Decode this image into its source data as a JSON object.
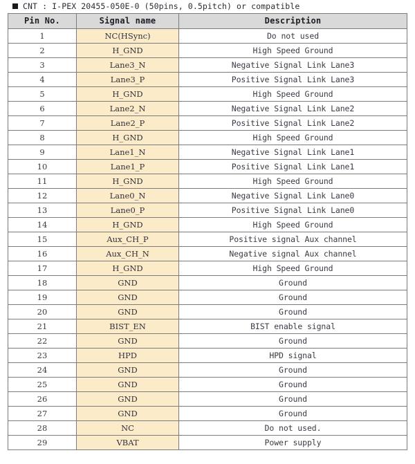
{
  "caption": {
    "bullet_icon": "filled-square-bullet",
    "text": "CNT :  I-PEX 20455-050E-0 (50pins, 0.5pitch) or compatible"
  },
  "table": {
    "columns": [
      "Pin No.",
      "Signal name",
      "Description"
    ],
    "rows": [
      {
        "pin": "1",
        "signal": "NC(HSync)",
        "description": "Do not used"
      },
      {
        "pin": "2",
        "signal": "H_GND",
        "description": "High Speed Ground"
      },
      {
        "pin": "3",
        "signal": "Lane3_N",
        "description": "Negative Signal Link Lane3"
      },
      {
        "pin": "4",
        "signal": "Lane3_P",
        "description": "Positive Signal Link Lane3"
      },
      {
        "pin": "5",
        "signal": "H_GND",
        "description": "High Speed Ground"
      },
      {
        "pin": "6",
        "signal": "Lane2_N",
        "description": "Negative Signal Link Lane2"
      },
      {
        "pin": "7",
        "signal": "Lane2_P",
        "description": "Positive Signal Link Lane2"
      },
      {
        "pin": "8",
        "signal": "H_GND",
        "description": "High Speed Ground"
      },
      {
        "pin": "9",
        "signal": "Lane1_N",
        "description": "Negative Signal Link Lane1"
      },
      {
        "pin": "10",
        "signal": "Lane1_P",
        "description": "Positive Signal Link Lane1"
      },
      {
        "pin": "11",
        "signal": "H_GND",
        "description": "High Speed Ground"
      },
      {
        "pin": "12",
        "signal": "Lane0_N",
        "description": "Negative Signal Link Lane0"
      },
      {
        "pin": "13",
        "signal": "Lane0_P",
        "description": "Positive Signal Link Lane0"
      },
      {
        "pin": "14",
        "signal": "H_GND",
        "description": "High Speed Ground"
      },
      {
        "pin": "15",
        "signal": "Aux_CH_P",
        "description": "Positive signal Aux channel"
      },
      {
        "pin": "16",
        "signal": "Aux_CH_N",
        "description": "Negative signal Aux channel"
      },
      {
        "pin": "17",
        "signal": "H_GND",
        "description": "High Speed Ground"
      },
      {
        "pin": "18",
        "signal": "GND",
        "description": "Ground"
      },
      {
        "pin": "19",
        "signal": "GND",
        "description": "Ground"
      },
      {
        "pin": "20",
        "signal": "GND",
        "description": "Ground"
      },
      {
        "pin": "21",
        "signal": "BIST_EN",
        "description": "BIST enable signal"
      },
      {
        "pin": "22",
        "signal": "GND",
        "description": "Ground"
      },
      {
        "pin": "23",
        "signal": "HPD",
        "description": "HPD signal"
      },
      {
        "pin": "24",
        "signal": "GND",
        "description": "Ground"
      },
      {
        "pin": "25",
        "signal": "GND",
        "description": "Ground"
      },
      {
        "pin": "26",
        "signal": "GND",
        "description": "Ground"
      },
      {
        "pin": "27",
        "signal": "GND",
        "description": "Ground"
      },
      {
        "pin": "28",
        "signal": "NC",
        "description": "Do not used."
      },
      {
        "pin": "29",
        "signal": "VBAT",
        "description": "Power supply"
      }
    ]
  },
  "colors": {
    "header_fill": "#d9d9d9",
    "signal_fill": "#fcebc9",
    "border": "#7b7b7b",
    "text": "#2a2a33",
    "page_background": "#ffffff"
  }
}
